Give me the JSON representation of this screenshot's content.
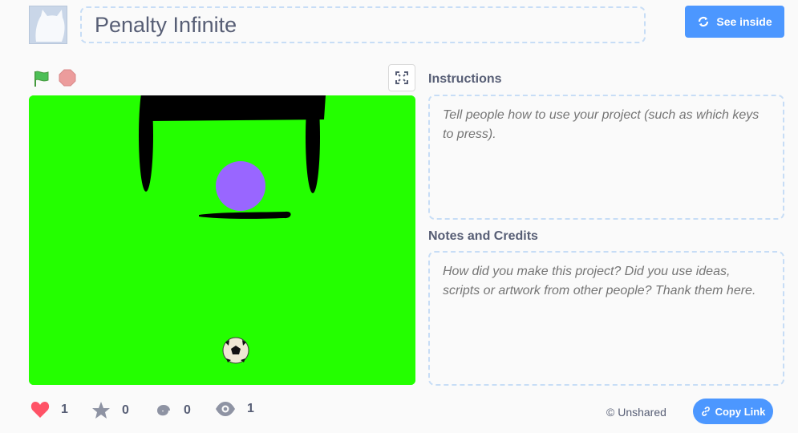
{
  "project": {
    "title": "Penalty Infinite",
    "see_inside_label": "See inside"
  },
  "player": {
    "green_flag_icon": "green-flag-icon",
    "stop_icon": "stop-sign-icon",
    "fullscreen_icon": "fullscreen-icon"
  },
  "instructions": {
    "heading": "Instructions",
    "placeholder": "Tell people how to use your project (such as which keys to press)."
  },
  "notes": {
    "heading": "Notes and Credits",
    "placeholder": "How did you make this project? Did you use ideas, scripts or artwork from other people? Thank them here."
  },
  "stats": {
    "loves": "1",
    "favorites": "0",
    "remixes": "0",
    "views": "1"
  },
  "share": {
    "status": "© Unshared",
    "copy_link_label": "Copy Link"
  },
  "colors": {
    "accent": "#4c97ff",
    "stage_background": "#24ff00",
    "goalkeeper": "#9966ff",
    "love": "#ff5266"
  }
}
